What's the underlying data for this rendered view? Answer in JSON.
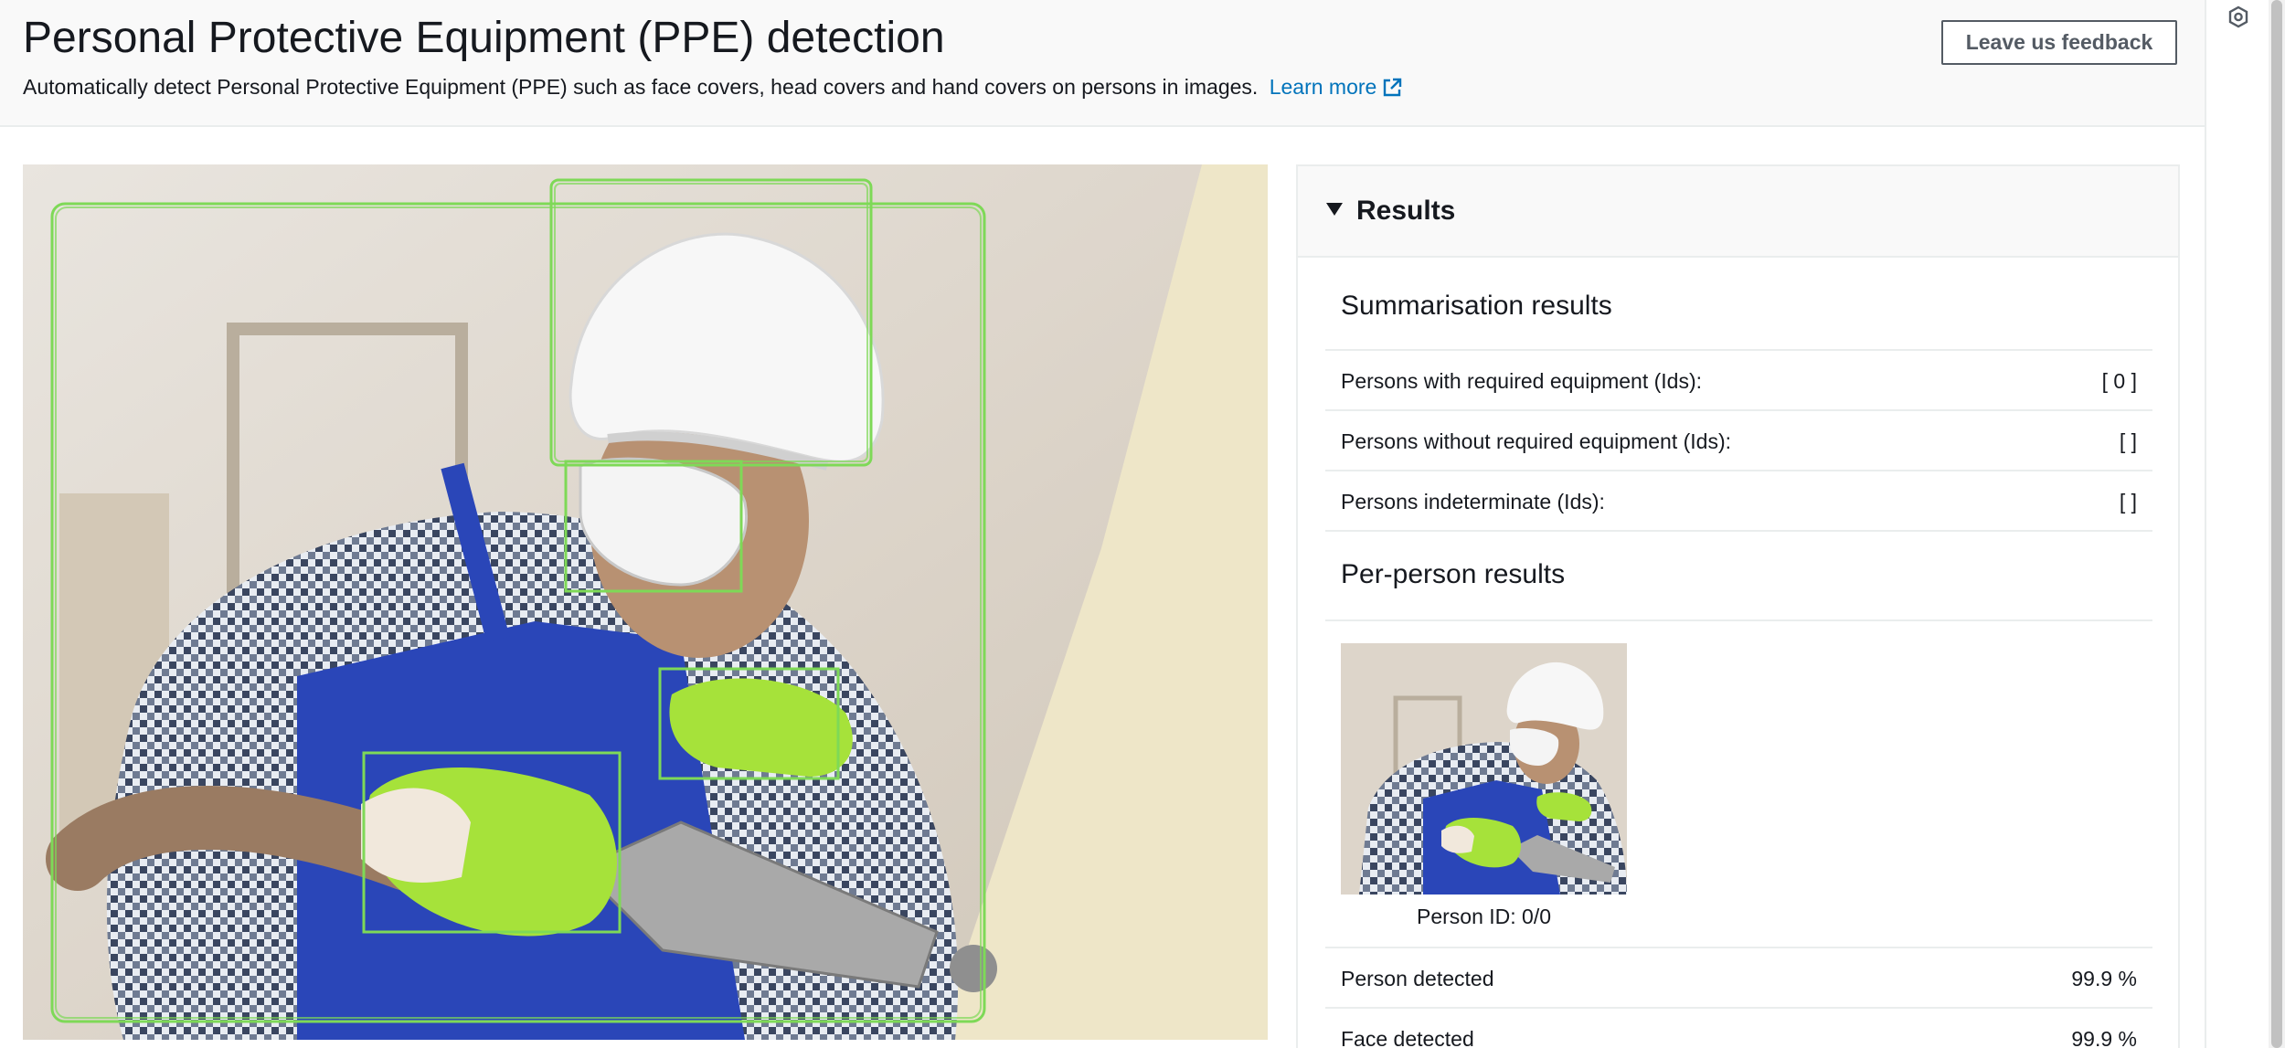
{
  "header": {
    "title": "Personal Protective Equipment (PPE) detection",
    "description": "Automatically detect Personal Protective Equipment (PPE) such as face covers, head covers and hand covers on persons in images.",
    "learn_more": "Learn more",
    "feedback_button": "Leave us feedback"
  },
  "results": {
    "title": "Results",
    "summary_title": "Summarisation results",
    "summary_rows": [
      {
        "label": "Persons with required equipment (Ids):",
        "value": "[ 0 ]"
      },
      {
        "label": "Persons without required equipment (Ids):",
        "value": "[ ]"
      },
      {
        "label": "Persons indeterminate (Ids):",
        "value": "[ ]"
      }
    ],
    "per_person_title": "Per-person results",
    "person_caption": "Person ID: 0/0",
    "detection_rows": [
      {
        "label": "Person detected",
        "value": "99.9 %"
      },
      {
        "label": "Face detected",
        "value": "99.9 %"
      }
    ]
  },
  "colors": {
    "bounding_box": "#7ed957",
    "link": "#0073bb",
    "apron": "#2a46b8",
    "glove": "#a6e23a"
  },
  "icons": [
    "external-link-icon",
    "caret-down-icon",
    "tools-icon"
  ]
}
